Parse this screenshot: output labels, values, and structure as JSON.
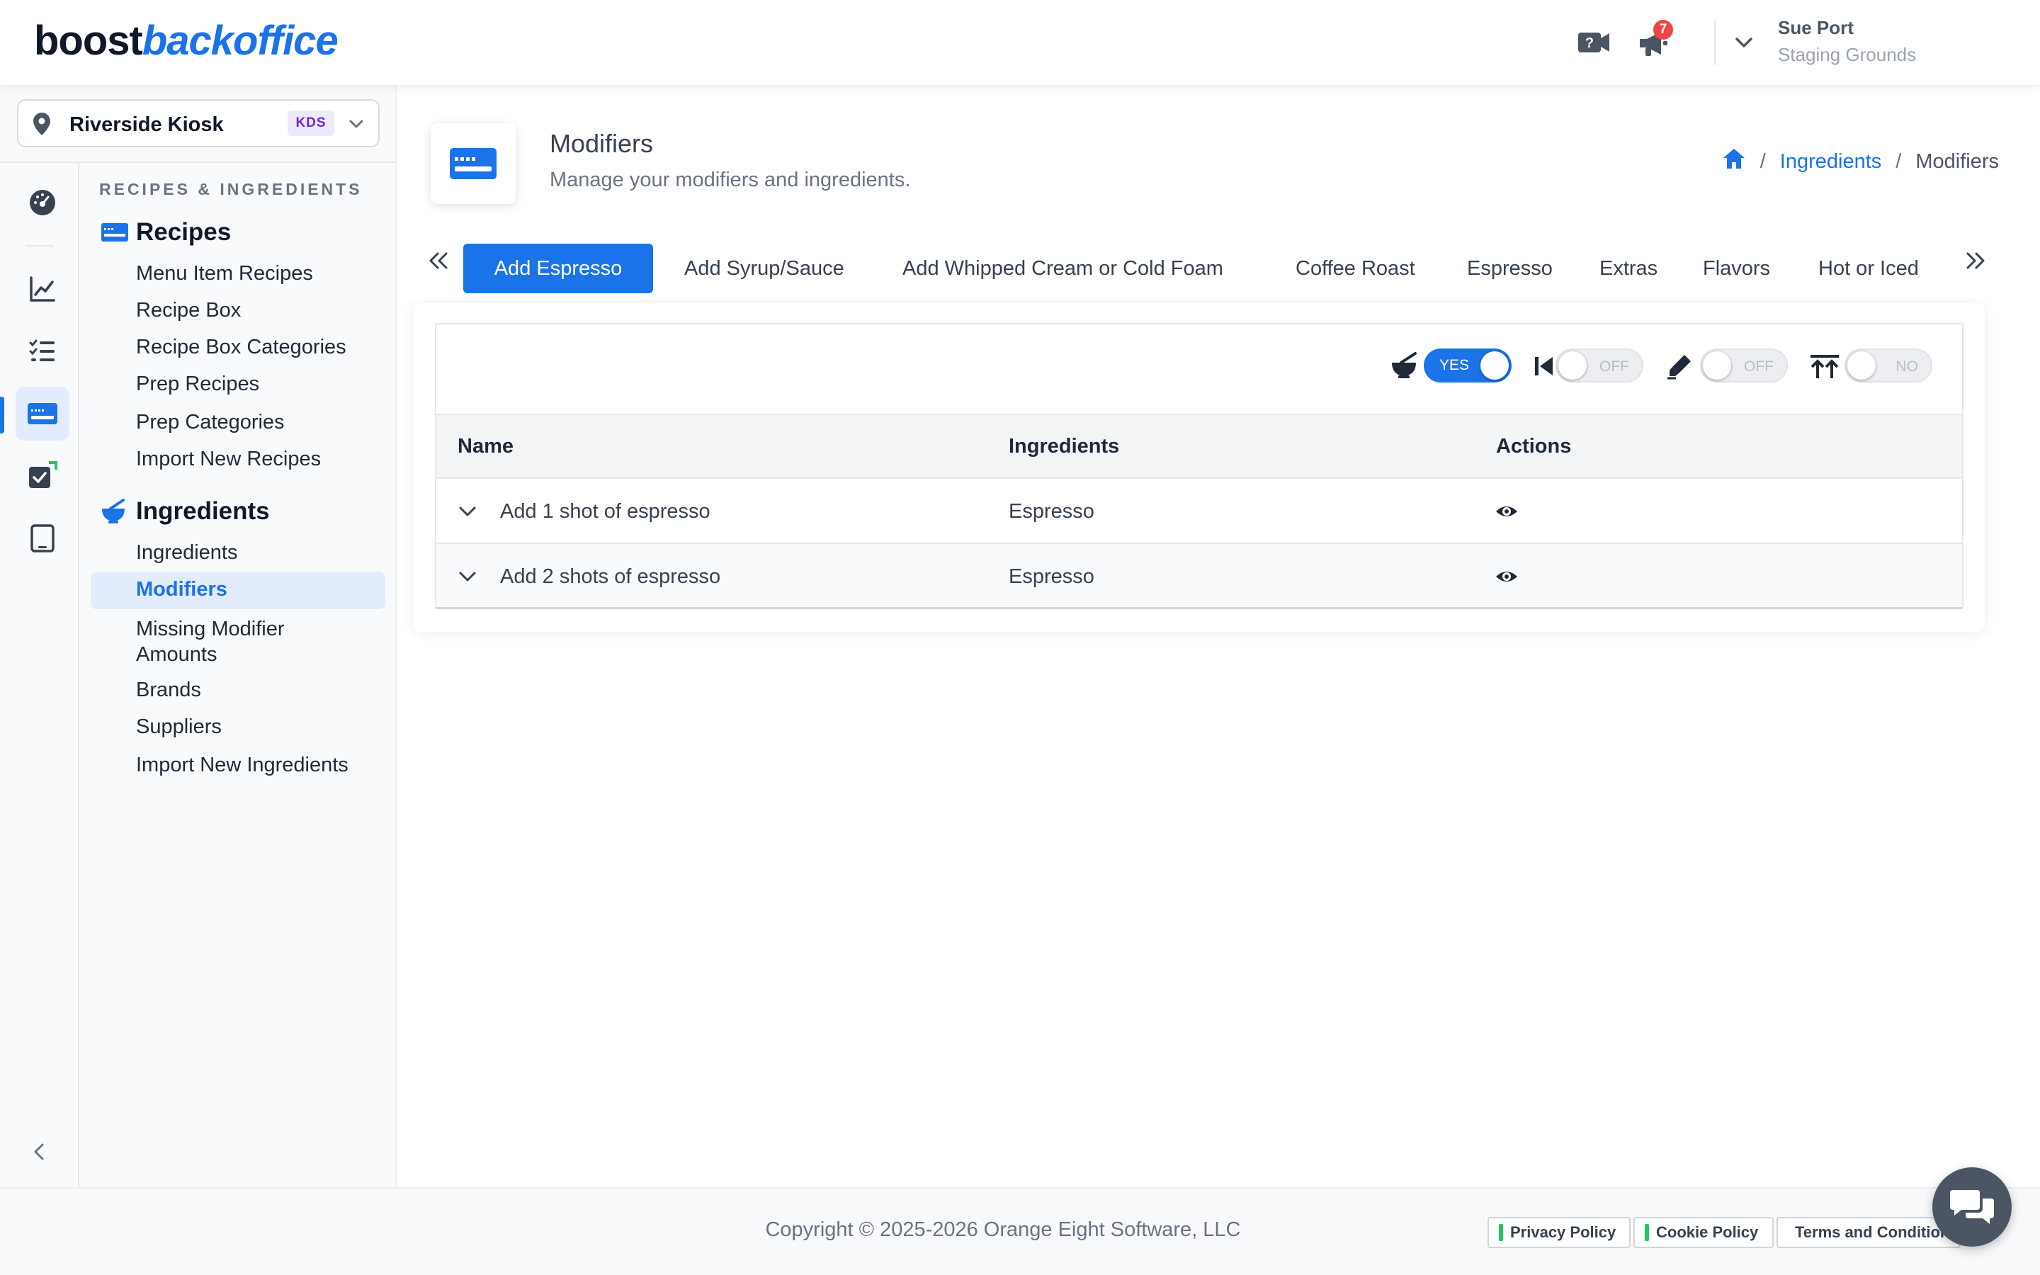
{
  "header": {
    "logo_part1": "boost",
    "logo_part2": "backoffice",
    "notification_count": "7",
    "user_name": "Sue Port",
    "user_org": "Staging Grounds"
  },
  "location": {
    "name": "Riverside Kiosk",
    "badge": "KDS"
  },
  "sidebar": {
    "section_label": "RECIPES & INGREDIENTS",
    "recipes": {
      "title": "Recipes",
      "items": [
        "Menu Item Recipes",
        "Recipe Box",
        "Recipe Box Categories",
        "Prep Recipes",
        "Prep Categories",
        "Import New Recipes"
      ]
    },
    "ingredients": {
      "title": "Ingredients",
      "items": [
        "Ingredients",
        "Modifiers",
        "Missing Modifier Amounts",
        "Brands",
        "Suppliers",
        "Import New Ingredients"
      ]
    }
  },
  "page": {
    "title": "Modifiers",
    "subtitle": "Manage your modifiers and ingredients."
  },
  "breadcrumb": {
    "link": "Ingredients",
    "current": "Modifiers"
  },
  "tabs": [
    "Add Espresso",
    "Add Syrup/Sauce",
    "Add Whipped Cream or Cold Foam",
    "Coffee Roast",
    "Espresso",
    "Extras",
    "Flavors",
    "Hot or Iced"
  ],
  "filters": [
    {
      "icon": "mortar-pestle-icon",
      "label": "YES",
      "on": true
    },
    {
      "icon": "skip-back-icon",
      "label": "OFF",
      "on": false
    },
    {
      "icon": "highlighter-icon",
      "label": "OFF",
      "on": false
    },
    {
      "icon": "arrow-up-to-line-icon",
      "label": "NO",
      "on": false
    }
  ],
  "table": {
    "columns": [
      "Name",
      "Ingredients",
      "Actions"
    ],
    "rows": [
      {
        "name": "Add 1 shot of espresso",
        "ingredients": "Espresso"
      },
      {
        "name": "Add 2 shots of espresso",
        "ingredients": "Espresso"
      }
    ]
  },
  "footer": {
    "copyright": "Copyright © 2025-2026 Orange Eight Software, LLC",
    "links": [
      "Privacy Policy",
      "Cookie Policy",
      "Terms and Conditions"
    ]
  },
  "colors": {
    "accent": "#1a73e8",
    "badge_red": "#ef4444",
    "policy_green": "#22c55e"
  }
}
